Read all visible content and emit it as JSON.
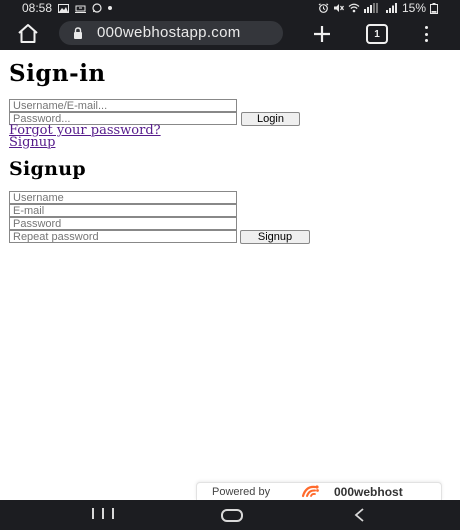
{
  "status_bar": {
    "time": "08:58",
    "battery": "15%"
  },
  "browser": {
    "url": "000webhostapp.com",
    "tab_count": "1"
  },
  "signin": {
    "title": "Sign-in",
    "username_placeholder": "Username/E-mail...",
    "password_placeholder": "Password...",
    "login_label": "Login",
    "forgot_link": "Forgot your password?",
    "signup_link": "Signup"
  },
  "signup": {
    "title": "Signup",
    "username_placeholder": "Username",
    "email_placeholder": "E-mail",
    "password_placeholder": "Password",
    "repeat_password_placeholder": "Repeat password",
    "signup_label": "Signup"
  },
  "footer_badge": {
    "powered_text": "Powered by",
    "brand": "000webhost"
  },
  "colors": {
    "system_bar": "#1c1d21",
    "url_pill": "#34363b",
    "visited_link": "#551a8b",
    "brand_orange": "#ff6a2c"
  },
  "icons": {
    "home": "home-icon",
    "lock": "lock-icon",
    "new_tab": "plus-icon",
    "menu": "more-vert-icon",
    "nav_recent": "recents-icon",
    "nav_home": "nav-home-icon",
    "nav_back": "back-icon"
  }
}
